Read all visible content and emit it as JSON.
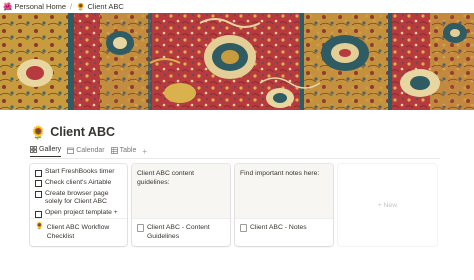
{
  "breadcrumb": {
    "items": [
      {
        "emoji": "🌺",
        "label": "Personal Home"
      },
      {
        "emoji": "🌻",
        "label": "Client ABC"
      }
    ],
    "separator": "/"
  },
  "page": {
    "icon": "🌻",
    "title": "Client ABC"
  },
  "tabs": [
    {
      "label": "Gallery",
      "icon": "gallery-icon",
      "active": true
    },
    {
      "label": "Calendar",
      "icon": "calendar-icon",
      "active": false
    },
    {
      "label": "Table",
      "icon": "table-icon",
      "active": false
    }
  ],
  "add_view_symbol": "+",
  "cards": [
    {
      "todos": [
        "Start FreshBooks timer",
        "Check client's Airtable",
        "Create browser page solely for Client ABC",
        "Open project template +"
      ],
      "name_icon": "🌻",
      "name": "Client ABC Workflow Checklist"
    },
    {
      "preview_text": "Client ABC content guidelines:",
      "name": "Client ABC - Content Guidelines"
    },
    {
      "preview_text": "Find important notes here:",
      "name": "Client ABC - Notes"
    }
  ],
  "new_card_label": "+ New",
  "colors": {
    "text": "#37352f",
    "muted": "#787774",
    "rug_red": "#b63a3e",
    "rug_gold": "#c79b3e",
    "rug_teal": "#2f5c63"
  }
}
